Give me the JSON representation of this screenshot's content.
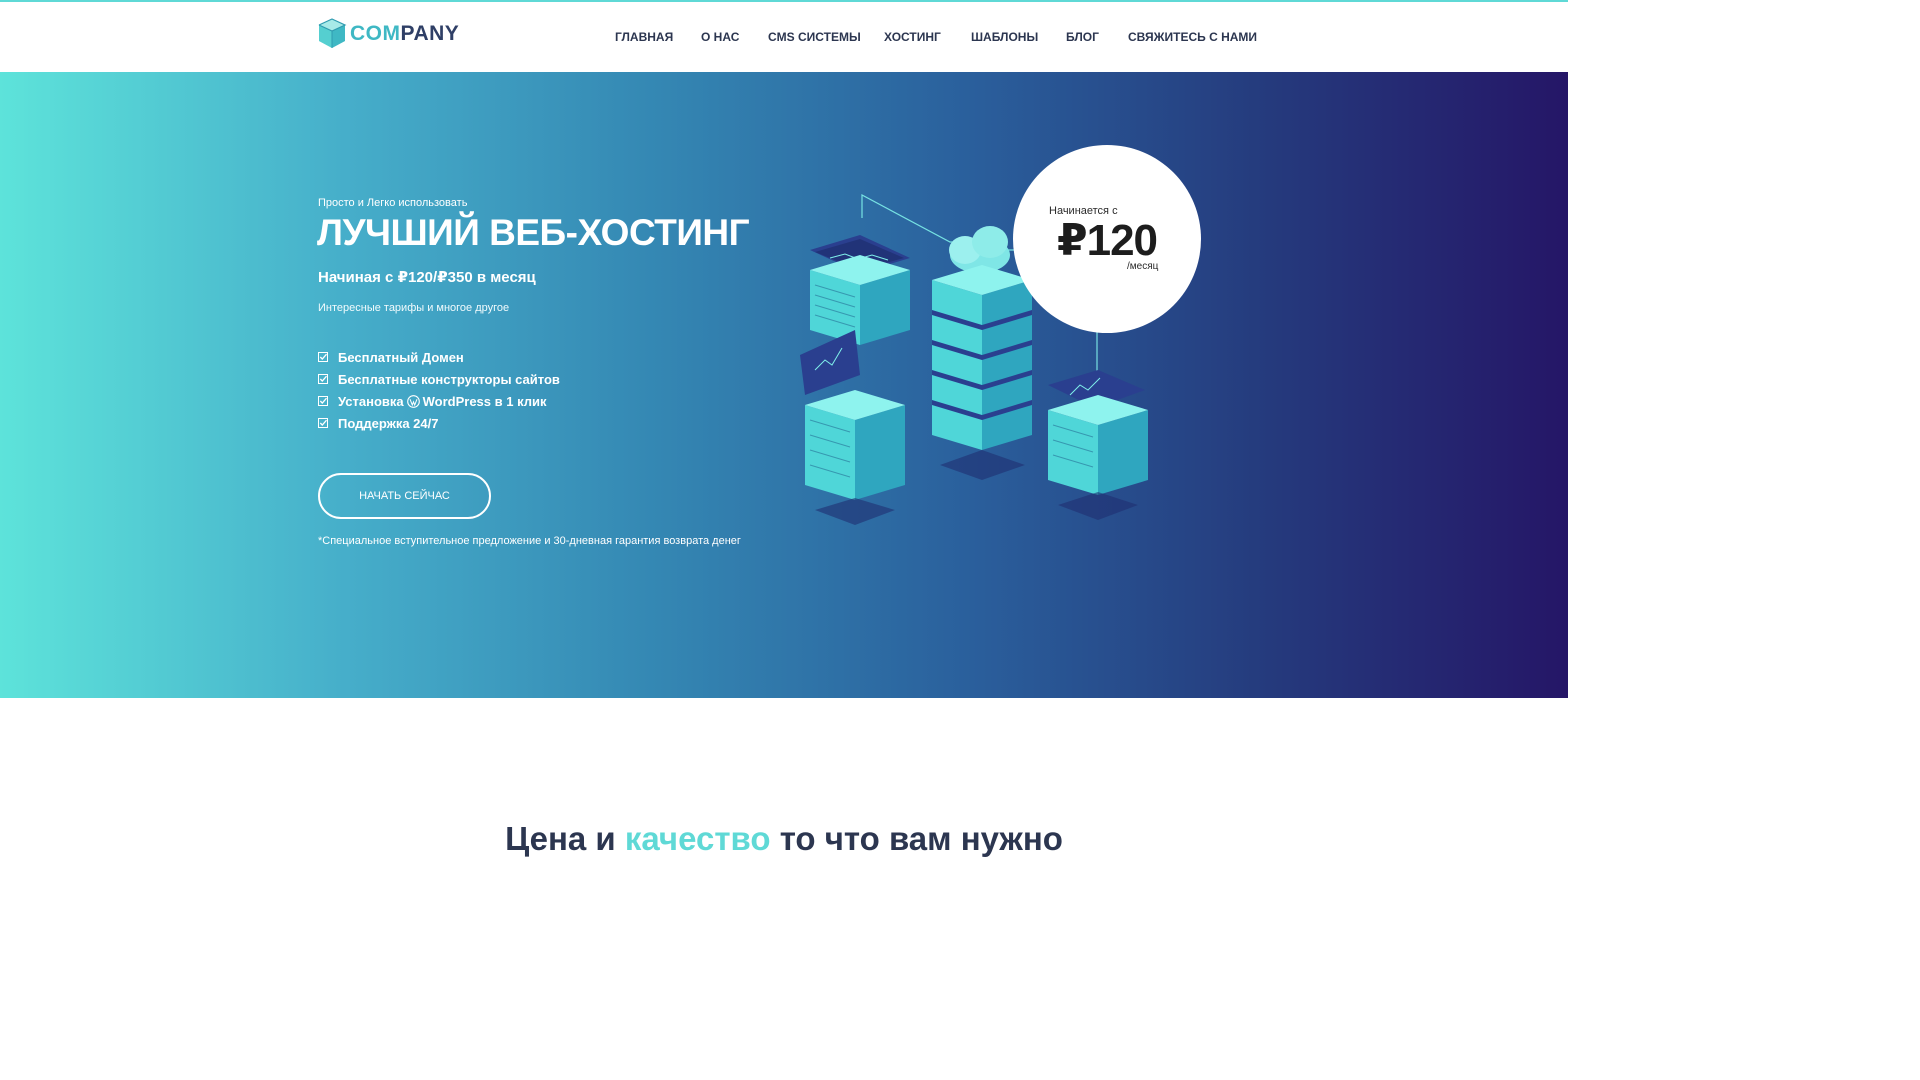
{
  "brand": {
    "logo_part1": "COM",
    "logo_part2": "PANY"
  },
  "nav": {
    "items": [
      {
        "label": "ГЛАВНАЯ"
      },
      {
        "label": "О НАС"
      },
      {
        "label": "CMS СИСТЕМЫ"
      },
      {
        "label": "ХОСТИНГ"
      },
      {
        "label": "ШАБЛОНЫ"
      },
      {
        "label": "БЛОГ"
      },
      {
        "label": "СВЯЖИТЕСЬ С НАМИ"
      }
    ]
  },
  "hero": {
    "kicker": "Просто и Легко использовать",
    "title": "ЛУЧШИЙ ВЕБ-ХОСТИНГ",
    "price_line": "Начиная с ₽120/₽350 в месяц",
    "description": "Интересные тарифы и многое другое",
    "features": [
      {
        "label": "Бесплатный Домен"
      },
      {
        "label": "Бесплатные конструкторы сайтов"
      },
      {
        "label_before": "Установка",
        "label_after": "WordPress в 1 клик",
        "icon": "wordpress-icon"
      },
      {
        "label": "Поддержка 24/7"
      }
    ],
    "cta_label": "НАЧАТЬ СЕЙЧАС",
    "note": "*Специальное вступительное предложение и 30-дневная гарантия возврата денег"
  },
  "badge": {
    "top": "Начинается с",
    "price": "₽120",
    "unit": "/месяц"
  },
  "section": {
    "title_part1": "Цена и",
    "title_accent": "качество",
    "title_part2": "то что вам нужно"
  },
  "colors": {
    "accent": "#5fd9d6",
    "text_dark": "#2c3650",
    "gradient_start": "#5de3da",
    "gradient_end": "#251667"
  },
  "icons": [
    "logo-cube-icon",
    "check-icon",
    "wordpress-icon"
  ]
}
